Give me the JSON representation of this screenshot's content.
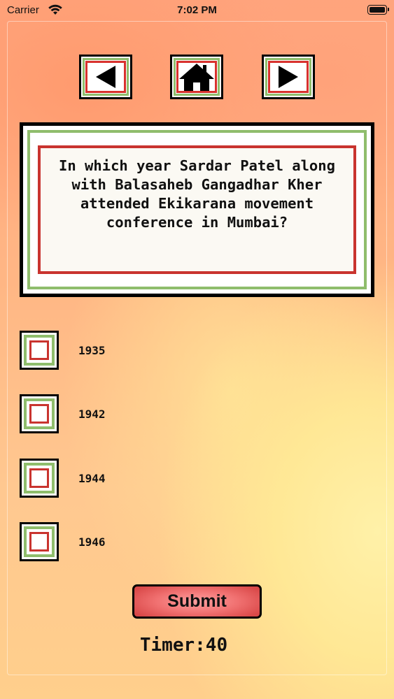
{
  "status_bar": {
    "carrier": "Carrier",
    "time": "7:02 PM"
  },
  "nav": {
    "prev_icon": "left-triangle-icon",
    "home_icon": "house-icon",
    "next_icon": "right-triangle-icon"
  },
  "question": {
    "text": "In which year Sardar Patel along with Balasaheb Gangadhar Kher attended Ekikarana movement conference in Mumbai?"
  },
  "options": [
    {
      "label": "1935",
      "checked": false
    },
    {
      "label": "1942",
      "checked": false
    },
    {
      "label": "1944",
      "checked": false
    },
    {
      "label": "1946",
      "checked": false
    }
  ],
  "submit_label": "Submit",
  "timer": "Timer:40",
  "colors": {
    "frame_green": "#8fbd6c",
    "frame_red": "#c9342f",
    "submit_red": "#f07070"
  }
}
